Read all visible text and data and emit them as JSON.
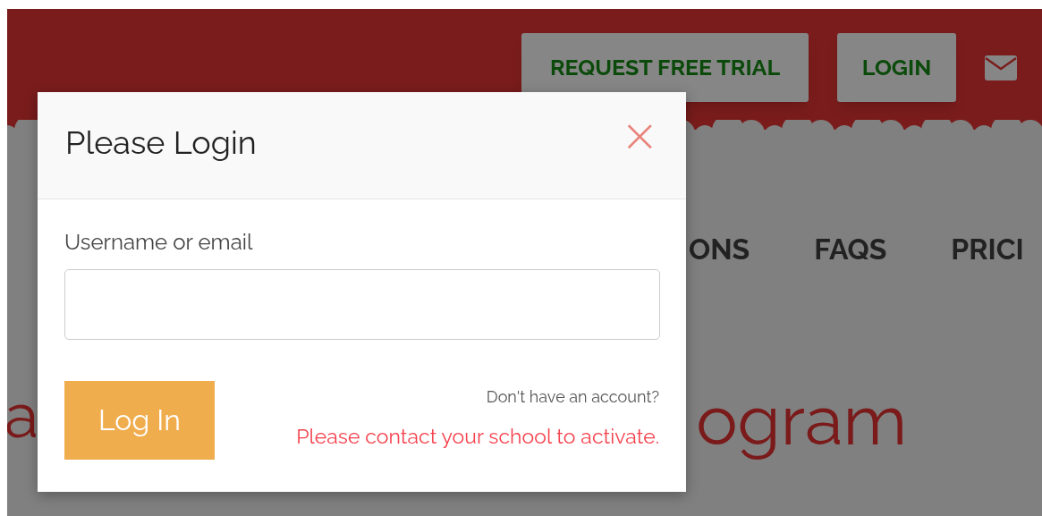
{
  "header": {
    "buttons": [
      {
        "label": "REQUEST FREE TRIAL"
      },
      {
        "label": "LOGIN"
      }
    ]
  },
  "nav": {
    "items": [
      {
        "label": "ONS"
      },
      {
        "label": "FAQS"
      },
      {
        "label": "PRICI"
      }
    ]
  },
  "headline": {
    "line_1_left": "a",
    "line_1_right": "ogram"
  },
  "modal": {
    "title": "Please Login",
    "close": "×",
    "field_label": "Username or email",
    "submit": "Log In",
    "account_prompt": "Don't have an account?",
    "activation_note": "Please contact your school to activate."
  }
}
